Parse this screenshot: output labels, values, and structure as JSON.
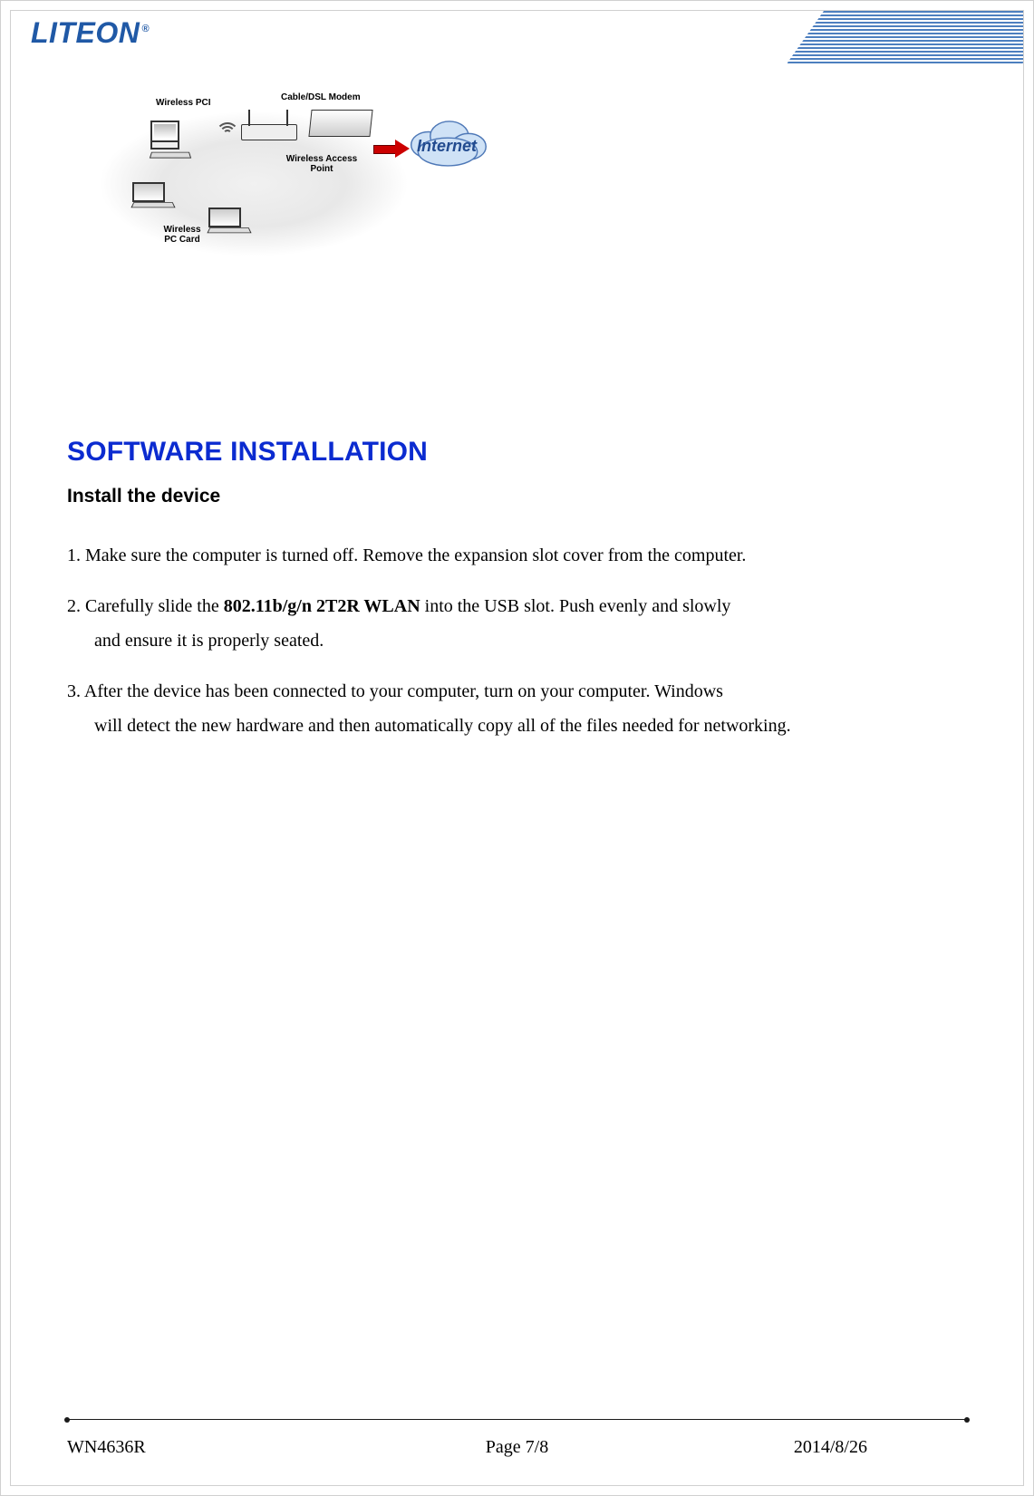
{
  "header": {
    "logo_text": "LITEON",
    "logo_registered": "®"
  },
  "diagram": {
    "labels": {
      "wireless_pci": "Wireless PCI",
      "cable_dsl_modem": "Cable/DSL Modem",
      "wireless_access_point": "Wireless Access Point",
      "wireless_pc_card": "Wireless PC Card",
      "internet": "Internet"
    }
  },
  "content": {
    "title": "SOFTWARE INSTALLATION",
    "subtitle": "Install the device",
    "steps": [
      {
        "lead": "1. Make sure the computer is turned off. Remove the expansion slot cover from the computer.",
        "cont": ""
      },
      {
        "lead": "2. Carefully slide the ",
        "bold": "802.11b/g/n 2T2R WLAN",
        "after_bold": " into the USB slot. Push evenly and slowly",
        "cont": "and ensure it is properly seated."
      },
      {
        "lead": "3. After the device has been connected to your computer, turn on your computer. Windows",
        "cont": "will detect the new hardware and then automatically copy all of the files needed for networking."
      }
    ]
  },
  "footer": {
    "model": "WN4636R",
    "page": "Page 7/8",
    "date": "2014/8/26"
  }
}
